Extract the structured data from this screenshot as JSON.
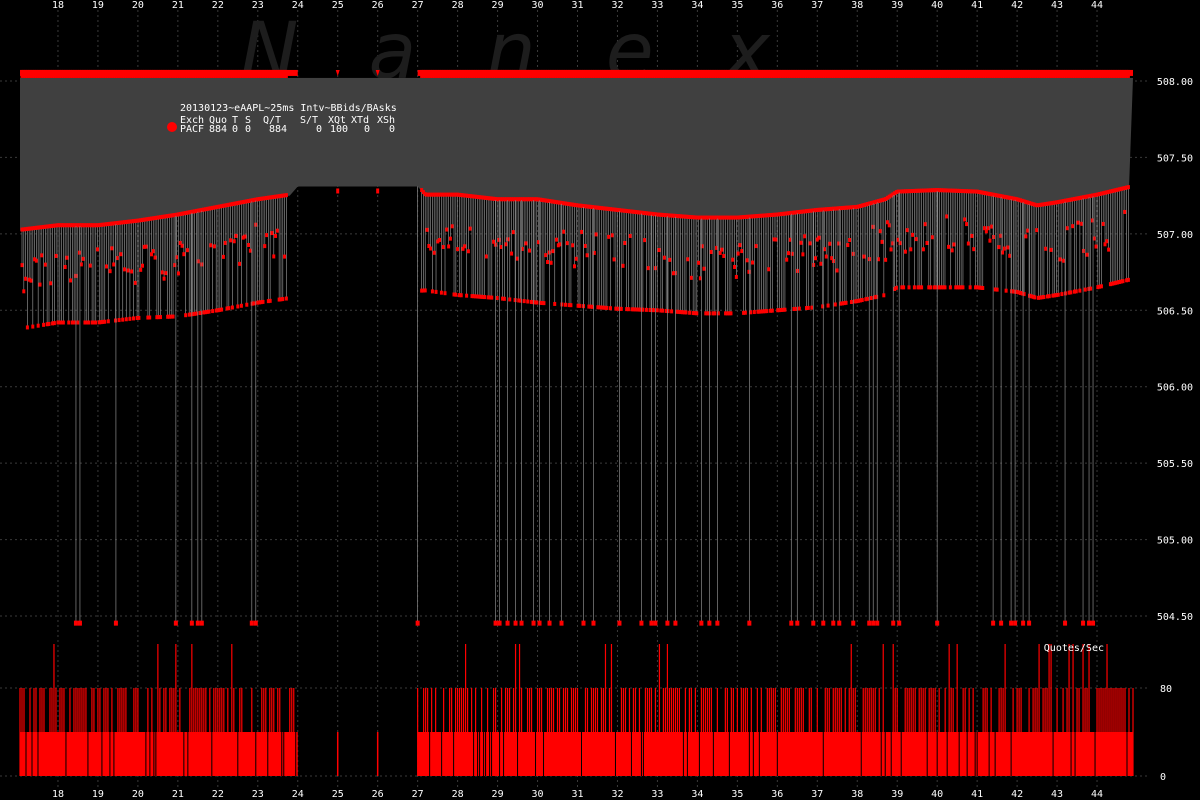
{
  "chart_data": [
    {
      "type": "scatter",
      "description_words": "price panel",
      "title": "20130123~eAAPL~25ms Intv~BBids/BAsks",
      "watermark": "Nanex",
      "x_ticks": [
        "18",
        "19",
        "20",
        "21",
        "22",
        "23",
        "24",
        "25",
        "26",
        "27",
        "28",
        "29",
        "30",
        "31",
        "32",
        "33",
        "34",
        "35",
        "36",
        "37",
        "38",
        "39",
        "40",
        "41",
        "42",
        "43",
        "44"
      ],
      "x_range": [
        17.05,
        44.9
      ],
      "y_ticks": [
        "508.00",
        "507.50",
        "507.00",
        "506.50",
        "506.00",
        "505.50",
        "505.00",
        "504.50"
      ],
      "ylim": [
        504.5,
        508.0
      ],
      "grid": true,
      "legend_position": "top-left",
      "legend": {
        "header": [
          "Exch",
          "Quo",
          "T",
          "S",
          "Q/T",
          "S/T",
          "XQt",
          "XTd",
          "XSh"
        ],
        "row": [
          "PACF",
          "884",
          "0",
          "0",
          "884",
          "0",
          "100",
          "0",
          "0"
        ],
        "marker_color": "#ff0000"
      },
      "colors": {
        "background": "#000000",
        "quote_fill": "#404040",
        "marker": "#ff0000",
        "grid": "#3a3a3a",
        "text": "#ffffff"
      },
      "series": [
        {
          "kind": "ask_envelope",
          "x": [
            17.05,
            24.0,
            24.0,
            27.0,
            27.0,
            44.9
          ],
          "y": [
            508.02,
            508.02,
            508.02,
            508.02,
            508.02,
            508.02
          ]
        },
        {
          "kind": "bid_envelope",
          "x": [
            17.05,
            18.0,
            19.0,
            20.0,
            21.0,
            22.0,
            23.0,
            23.8,
            24.0,
            27.0,
            27.2,
            28.0,
            29.0,
            30.0,
            31.0,
            32.0,
            33.0,
            34.0,
            35.0,
            36.0,
            37.0,
            38.0,
            38.7,
            39.0,
            40.0,
            41.0,
            42.0,
            42.5,
            43.0,
            44.0,
            44.8
          ],
          "y": [
            507.02,
            507.05,
            507.05,
            507.08,
            507.12,
            507.17,
            507.22,
            507.25,
            507.31,
            507.31,
            507.25,
            507.25,
            507.22,
            507.22,
            507.18,
            507.15,
            507.12,
            507.1,
            507.1,
            507.12,
            507.15,
            507.17,
            507.22,
            507.27,
            507.28,
            507.27,
            507.22,
            507.18,
            507.2,
            507.25,
            507.3
          ]
        },
        {
          "kind": "bid_lower_band",
          "x": [
            17.05,
            18.0,
            19.0,
            20.0,
            21.0,
            22.0,
            23.0,
            23.8,
            27.2,
            28.0,
            29.0,
            30.0,
            31.0,
            32.0,
            33.0,
            34.0,
            35.0,
            36.0,
            37.0,
            38.0,
            38.7,
            39.0,
            40.0,
            41.0,
            42.0,
            42.5,
            43.0,
            44.0,
            44.8
          ],
          "y": [
            506.38,
            506.42,
            506.42,
            506.45,
            506.46,
            506.5,
            506.55,
            506.58,
            506.63,
            506.6,
            506.58,
            506.55,
            506.53,
            506.51,
            506.5,
            506.48,
            506.48,
            506.5,
            506.52,
            506.56,
            506.6,
            506.65,
            506.65,
            506.65,
            506.62,
            506.58,
            506.6,
            506.65,
            506.7
          ]
        },
        {
          "kind": "deep_bid_drops",
          "x": [
            18.45,
            18.55,
            19.45,
            20.95,
            21.35,
            21.5,
            21.6,
            22.85,
            22.95,
            27.0,
            28.95,
            29.05,
            29.25,
            29.45,
            29.6,
            29.9,
            30.05,
            30.3,
            30.6,
            31.15,
            31.4,
            32.05,
            32.6,
            32.85,
            32.95,
            33.25,
            33.45,
            34.1,
            34.3,
            34.5,
            35.3,
            36.35,
            36.5,
            36.9,
            37.15,
            37.4,
            37.55,
            37.9,
            38.3,
            38.4,
            38.5,
            38.9,
            39.05,
            40.0,
            41.4,
            41.6,
            41.85,
            41.95,
            42.15,
            42.3,
            43.2,
            43.65,
            43.8,
            43.9
          ],
          "y": 504.45
        },
        {
          "kind": "sparse_gap_ticks",
          "x": [
            25.0,
            26.0
          ]
        }
      ]
    },
    {
      "type": "bar",
      "description_words": "quote rate panel",
      "title": "Quotes/Sec",
      "x_range": [
        17.05,
        44.9
      ],
      "y_ticks": [
        "80",
        "0"
      ],
      "ylim": [
        0,
        80
      ],
      "colors": {
        "bar": "#ff0000"
      },
      "active_ranges": [
        [
          17.05,
          24.0
        ],
        [
          27.0,
          44.9
        ]
      ],
      "sparse_x": [
        25.0,
        26.0
      ],
      "base_level": 40,
      "high_level": 80,
      "spike_level": 120
    }
  ]
}
